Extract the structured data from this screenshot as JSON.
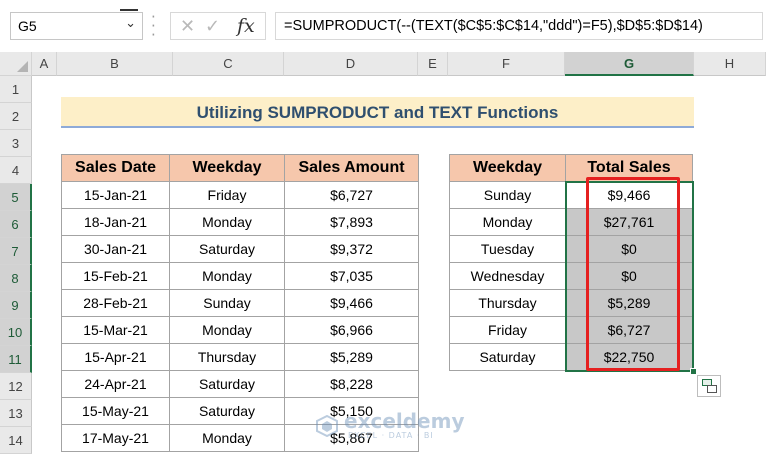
{
  "formula_bar": {
    "name_box": "G5",
    "fx_label": "fx",
    "formula": "=SUMPRODUCT(--(TEXT($C$5:$C$14,\"ddd\")=F5),$D$5:$D$14)"
  },
  "columns": [
    "A",
    "B",
    "C",
    "D",
    "E",
    "F",
    "G",
    "H"
  ],
  "rows": [
    "1",
    "2",
    "3",
    "4",
    "5",
    "6",
    "7",
    "8",
    "9",
    "10",
    "11",
    "12",
    "13",
    "14"
  ],
  "title": "Utilizing SUMPRODUCT and TEXT Functions",
  "main_table": {
    "headers": [
      "Sales Date",
      "Weekday",
      "Sales Amount"
    ],
    "rows": [
      [
        "15-Jan-21",
        "Friday",
        "$6,727"
      ],
      [
        "18-Jan-21",
        "Monday",
        "$7,893"
      ],
      [
        "30-Jan-21",
        "Saturday",
        "$9,372"
      ],
      [
        "15-Feb-21",
        "Monday",
        "$7,035"
      ],
      [
        "28-Feb-21",
        "Sunday",
        "$9,466"
      ],
      [
        "15-Mar-21",
        "Monday",
        "$6,966"
      ],
      [
        "15-Apr-21",
        "Thursday",
        "$5,289"
      ],
      [
        "24-Apr-21",
        "Saturday",
        "$8,228"
      ],
      [
        "15-May-21",
        "Saturday",
        "$5,150"
      ],
      [
        "17-May-21",
        "Monday",
        "$5,867"
      ]
    ]
  },
  "summary_table": {
    "headers": [
      "Weekday",
      "Total Sales"
    ],
    "rows": [
      [
        "Sunday",
        "$9,466"
      ],
      [
        "Monday",
        "$27,761"
      ],
      [
        "Tuesday",
        "$0"
      ],
      [
        "Wednesday",
        "$0"
      ],
      [
        "Thursday",
        "$5,289"
      ],
      [
        "Friday",
        "$6,727"
      ],
      [
        "Saturday",
        "$22,750"
      ]
    ]
  },
  "watermark": {
    "name": "exceldemy",
    "tagline": "EXCEL · DATA · BI"
  }
}
